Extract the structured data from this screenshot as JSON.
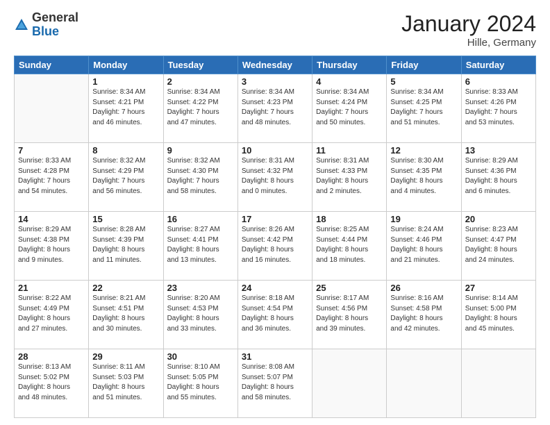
{
  "header": {
    "logo_general": "General",
    "logo_blue": "Blue",
    "title": "January 2024",
    "subtitle": "Hille, Germany"
  },
  "columns": [
    "Sunday",
    "Monday",
    "Tuesday",
    "Wednesday",
    "Thursday",
    "Friday",
    "Saturday"
  ],
  "weeks": [
    [
      {
        "day": "",
        "info": ""
      },
      {
        "day": "1",
        "info": "Sunrise: 8:34 AM\nSunset: 4:21 PM\nDaylight: 7 hours\nand 46 minutes."
      },
      {
        "day": "2",
        "info": "Sunrise: 8:34 AM\nSunset: 4:22 PM\nDaylight: 7 hours\nand 47 minutes."
      },
      {
        "day": "3",
        "info": "Sunrise: 8:34 AM\nSunset: 4:23 PM\nDaylight: 7 hours\nand 48 minutes."
      },
      {
        "day": "4",
        "info": "Sunrise: 8:34 AM\nSunset: 4:24 PM\nDaylight: 7 hours\nand 50 minutes."
      },
      {
        "day": "5",
        "info": "Sunrise: 8:34 AM\nSunset: 4:25 PM\nDaylight: 7 hours\nand 51 minutes."
      },
      {
        "day": "6",
        "info": "Sunrise: 8:33 AM\nSunset: 4:26 PM\nDaylight: 7 hours\nand 53 minutes."
      }
    ],
    [
      {
        "day": "7",
        "info": "Sunrise: 8:33 AM\nSunset: 4:28 PM\nDaylight: 7 hours\nand 54 minutes."
      },
      {
        "day": "8",
        "info": "Sunrise: 8:32 AM\nSunset: 4:29 PM\nDaylight: 7 hours\nand 56 minutes."
      },
      {
        "day": "9",
        "info": "Sunrise: 8:32 AM\nSunset: 4:30 PM\nDaylight: 7 hours\nand 58 minutes."
      },
      {
        "day": "10",
        "info": "Sunrise: 8:31 AM\nSunset: 4:32 PM\nDaylight: 8 hours\nand 0 minutes."
      },
      {
        "day": "11",
        "info": "Sunrise: 8:31 AM\nSunset: 4:33 PM\nDaylight: 8 hours\nand 2 minutes."
      },
      {
        "day": "12",
        "info": "Sunrise: 8:30 AM\nSunset: 4:35 PM\nDaylight: 8 hours\nand 4 minutes."
      },
      {
        "day": "13",
        "info": "Sunrise: 8:29 AM\nSunset: 4:36 PM\nDaylight: 8 hours\nand 6 minutes."
      }
    ],
    [
      {
        "day": "14",
        "info": "Sunrise: 8:29 AM\nSunset: 4:38 PM\nDaylight: 8 hours\nand 9 minutes."
      },
      {
        "day": "15",
        "info": "Sunrise: 8:28 AM\nSunset: 4:39 PM\nDaylight: 8 hours\nand 11 minutes."
      },
      {
        "day": "16",
        "info": "Sunrise: 8:27 AM\nSunset: 4:41 PM\nDaylight: 8 hours\nand 13 minutes."
      },
      {
        "day": "17",
        "info": "Sunrise: 8:26 AM\nSunset: 4:42 PM\nDaylight: 8 hours\nand 16 minutes."
      },
      {
        "day": "18",
        "info": "Sunrise: 8:25 AM\nSunset: 4:44 PM\nDaylight: 8 hours\nand 18 minutes."
      },
      {
        "day": "19",
        "info": "Sunrise: 8:24 AM\nSunset: 4:46 PM\nDaylight: 8 hours\nand 21 minutes."
      },
      {
        "day": "20",
        "info": "Sunrise: 8:23 AM\nSunset: 4:47 PM\nDaylight: 8 hours\nand 24 minutes."
      }
    ],
    [
      {
        "day": "21",
        "info": "Sunrise: 8:22 AM\nSunset: 4:49 PM\nDaylight: 8 hours\nand 27 minutes."
      },
      {
        "day": "22",
        "info": "Sunrise: 8:21 AM\nSunset: 4:51 PM\nDaylight: 8 hours\nand 30 minutes."
      },
      {
        "day": "23",
        "info": "Sunrise: 8:20 AM\nSunset: 4:53 PM\nDaylight: 8 hours\nand 33 minutes."
      },
      {
        "day": "24",
        "info": "Sunrise: 8:18 AM\nSunset: 4:54 PM\nDaylight: 8 hours\nand 36 minutes."
      },
      {
        "day": "25",
        "info": "Sunrise: 8:17 AM\nSunset: 4:56 PM\nDaylight: 8 hours\nand 39 minutes."
      },
      {
        "day": "26",
        "info": "Sunrise: 8:16 AM\nSunset: 4:58 PM\nDaylight: 8 hours\nand 42 minutes."
      },
      {
        "day": "27",
        "info": "Sunrise: 8:14 AM\nSunset: 5:00 PM\nDaylight: 8 hours\nand 45 minutes."
      }
    ],
    [
      {
        "day": "28",
        "info": "Sunrise: 8:13 AM\nSunset: 5:02 PM\nDaylight: 8 hours\nand 48 minutes."
      },
      {
        "day": "29",
        "info": "Sunrise: 8:11 AM\nSunset: 5:03 PM\nDaylight: 8 hours\nand 51 minutes."
      },
      {
        "day": "30",
        "info": "Sunrise: 8:10 AM\nSunset: 5:05 PM\nDaylight: 8 hours\nand 55 minutes."
      },
      {
        "day": "31",
        "info": "Sunrise: 8:08 AM\nSunset: 5:07 PM\nDaylight: 8 hours\nand 58 minutes."
      },
      {
        "day": "",
        "info": ""
      },
      {
        "day": "",
        "info": ""
      },
      {
        "day": "",
        "info": ""
      }
    ]
  ]
}
